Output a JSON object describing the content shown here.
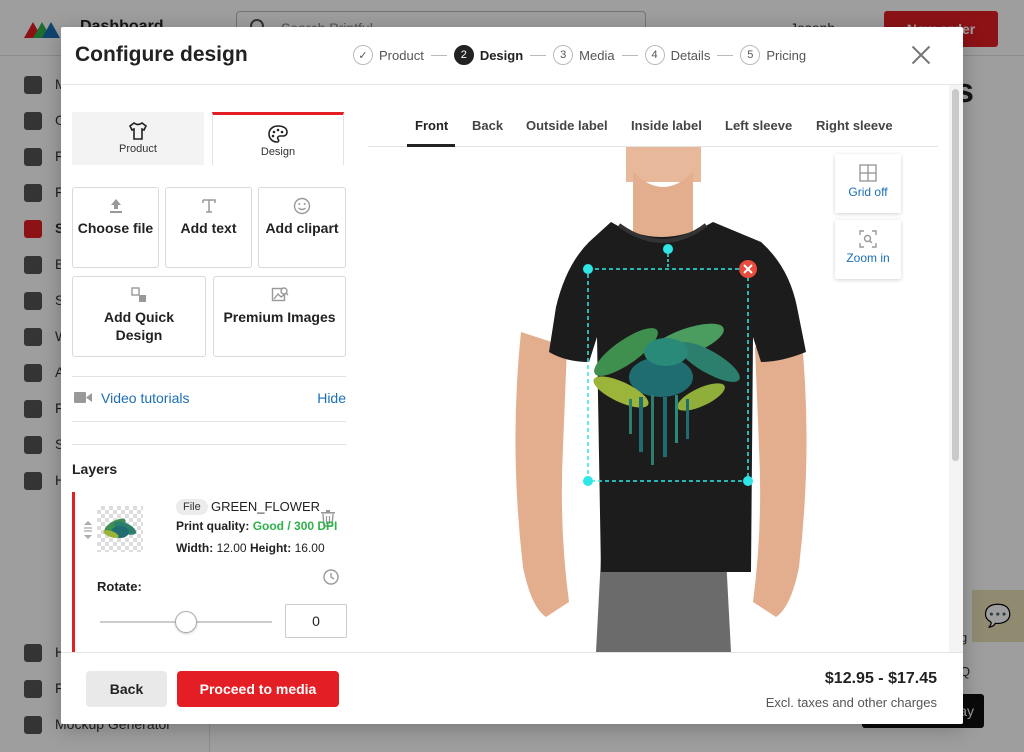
{
  "background": {
    "app_title": "Dashboard",
    "search_placeholder": "Search Printful",
    "user_name": "Joseph",
    "new_order_label": "New order",
    "page_heading": "s",
    "sidebar_items": [
      "M",
      "O",
      "F",
      "F",
      "S",
      "B",
      "S",
      "W",
      "A",
      "F",
      "S",
      "H"
    ],
    "sidebar_bottom_items": [
      "H",
      "F",
      "Mockup Generator"
    ],
    "dark_button_label": "ay",
    "side_letters": [
      "g",
      "Q"
    ]
  },
  "modal": {
    "title": "Configure design",
    "steps": [
      {
        "number": "✓",
        "label": "Product",
        "state": "done"
      },
      {
        "number": "2",
        "label": "Design",
        "state": "active"
      },
      {
        "number": "3",
        "label": "Media",
        "state": "upcoming"
      },
      {
        "number": "4",
        "label": "Details",
        "state": "upcoming"
      },
      {
        "number": "5",
        "label": "Pricing",
        "state": "upcoming"
      }
    ],
    "close_icon": "close-icon"
  },
  "left_panel": {
    "tabs": [
      {
        "label": "Product",
        "icon": "tshirt-icon",
        "active": false
      },
      {
        "label": "Design",
        "icon": "palette-icon",
        "active": true
      }
    ],
    "tools": [
      {
        "label": "Choose file",
        "icon": "upload-icon"
      },
      {
        "label": "Add text",
        "icon": "text-icon"
      },
      {
        "label": "Add clipart",
        "icon": "smiley-icon"
      },
      {
        "label": "Add Quick Design",
        "icon": "quick-design-icon"
      },
      {
        "label": "Premium Images",
        "icon": "image-search-icon"
      }
    ],
    "video_tutorials_label": "Video tutorials",
    "hide_label": "Hide",
    "layers_title": "Layers",
    "layer": {
      "badge": "File",
      "name": "GREEN_FLOWER",
      "print_quality_label": "Print quality:",
      "print_quality_value": "Good / 300 DPI",
      "width_label": "Width:",
      "width_value": "12.00",
      "height_label": "Height:",
      "height_value": "16.00",
      "rotate_label": "Rotate:",
      "rotate_value": "0",
      "rotate_fraction": 0.5
    }
  },
  "preview": {
    "view_tabs": [
      "Front",
      "Back",
      "Outside label",
      "Inside label",
      "Left sleeve",
      "Right sleeve"
    ],
    "active_view": "Front",
    "grid_button_label": "Grid off",
    "zoom_button_label": "Zoom in",
    "colors": {
      "shirt": "#1c1c1c",
      "guide": "#2ee6e6",
      "remove": "#e74c3c",
      "jeans": "#6b6b6b",
      "skin": "#e8b89a"
    }
  },
  "footer": {
    "back_label": "Back",
    "proceed_label": "Proceed to media",
    "price": "$12.95 - $17.45",
    "price_note": "Excl. taxes and other charges"
  },
  "colors": {
    "accent": "#e31e24",
    "link": "#1b6fb5",
    "good": "#2fb24b"
  }
}
